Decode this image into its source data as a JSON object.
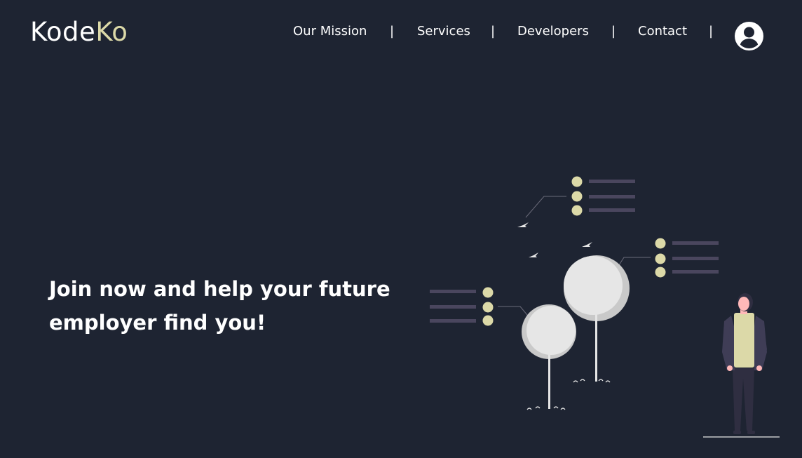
{
  "brand": {
    "name_part1": "Kode",
    "name_part2": "Ko",
    "accent_color": "#dcd9a8"
  },
  "nav": {
    "items": [
      {
        "label": "Our Mission"
      },
      {
        "label": "Services"
      },
      {
        "label": "Developers"
      },
      {
        "label": "Contact"
      }
    ],
    "separator": "|",
    "profile_icon": "user-circle-icon"
  },
  "hero": {
    "line1": "Join now and help your future",
    "line2": "employer find you!"
  },
  "colors": {
    "background": "#1e2432",
    "text": "#ffffff",
    "accent": "#dcd9a8",
    "illustration_lines": "#4a465e",
    "tree": "#e6e6e6"
  }
}
